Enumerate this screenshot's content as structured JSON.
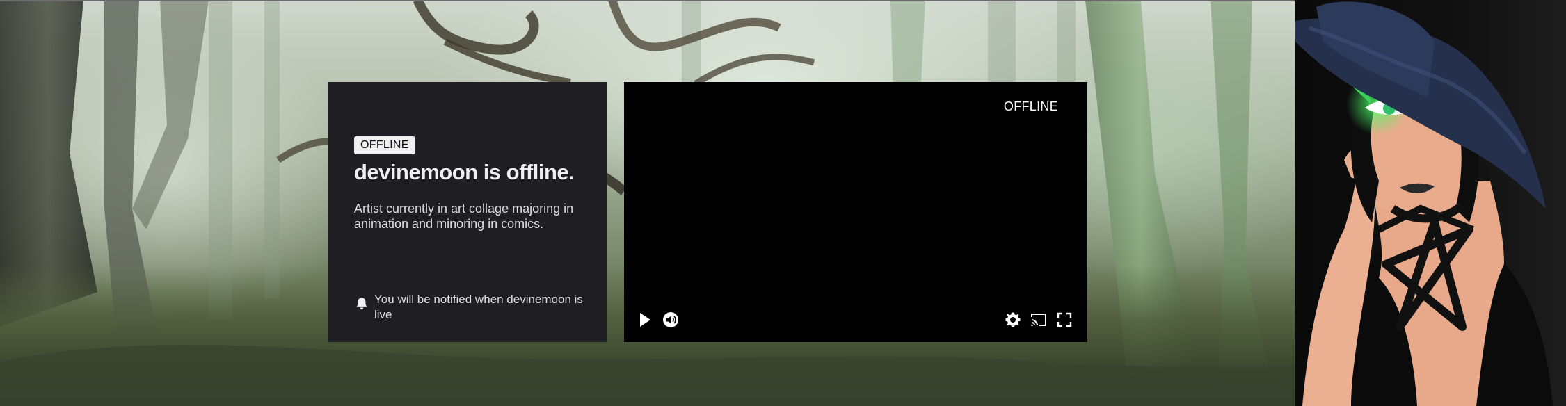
{
  "channel": {
    "offline_badge": "OFFLINE",
    "title": "devinemoon is offline.",
    "bio": "Artist currently in art collage majoring in animation and minoring in comics.",
    "notification": "You will be notified when devinemoon is live",
    "notification_icon": "bell-icon"
  },
  "player": {
    "status_label": "OFFLINE",
    "controls": {
      "left": [
        "play-icon",
        "volume-icon"
      ],
      "right": [
        "settings-gear-icon",
        "cast-icon",
        "fullscreen-icon"
      ]
    }
  },
  "colors": {
    "card_background": "#1f1f23",
    "player_background": "#000000",
    "badge_background": "#efeff1",
    "text_primary": "#efeff1"
  }
}
